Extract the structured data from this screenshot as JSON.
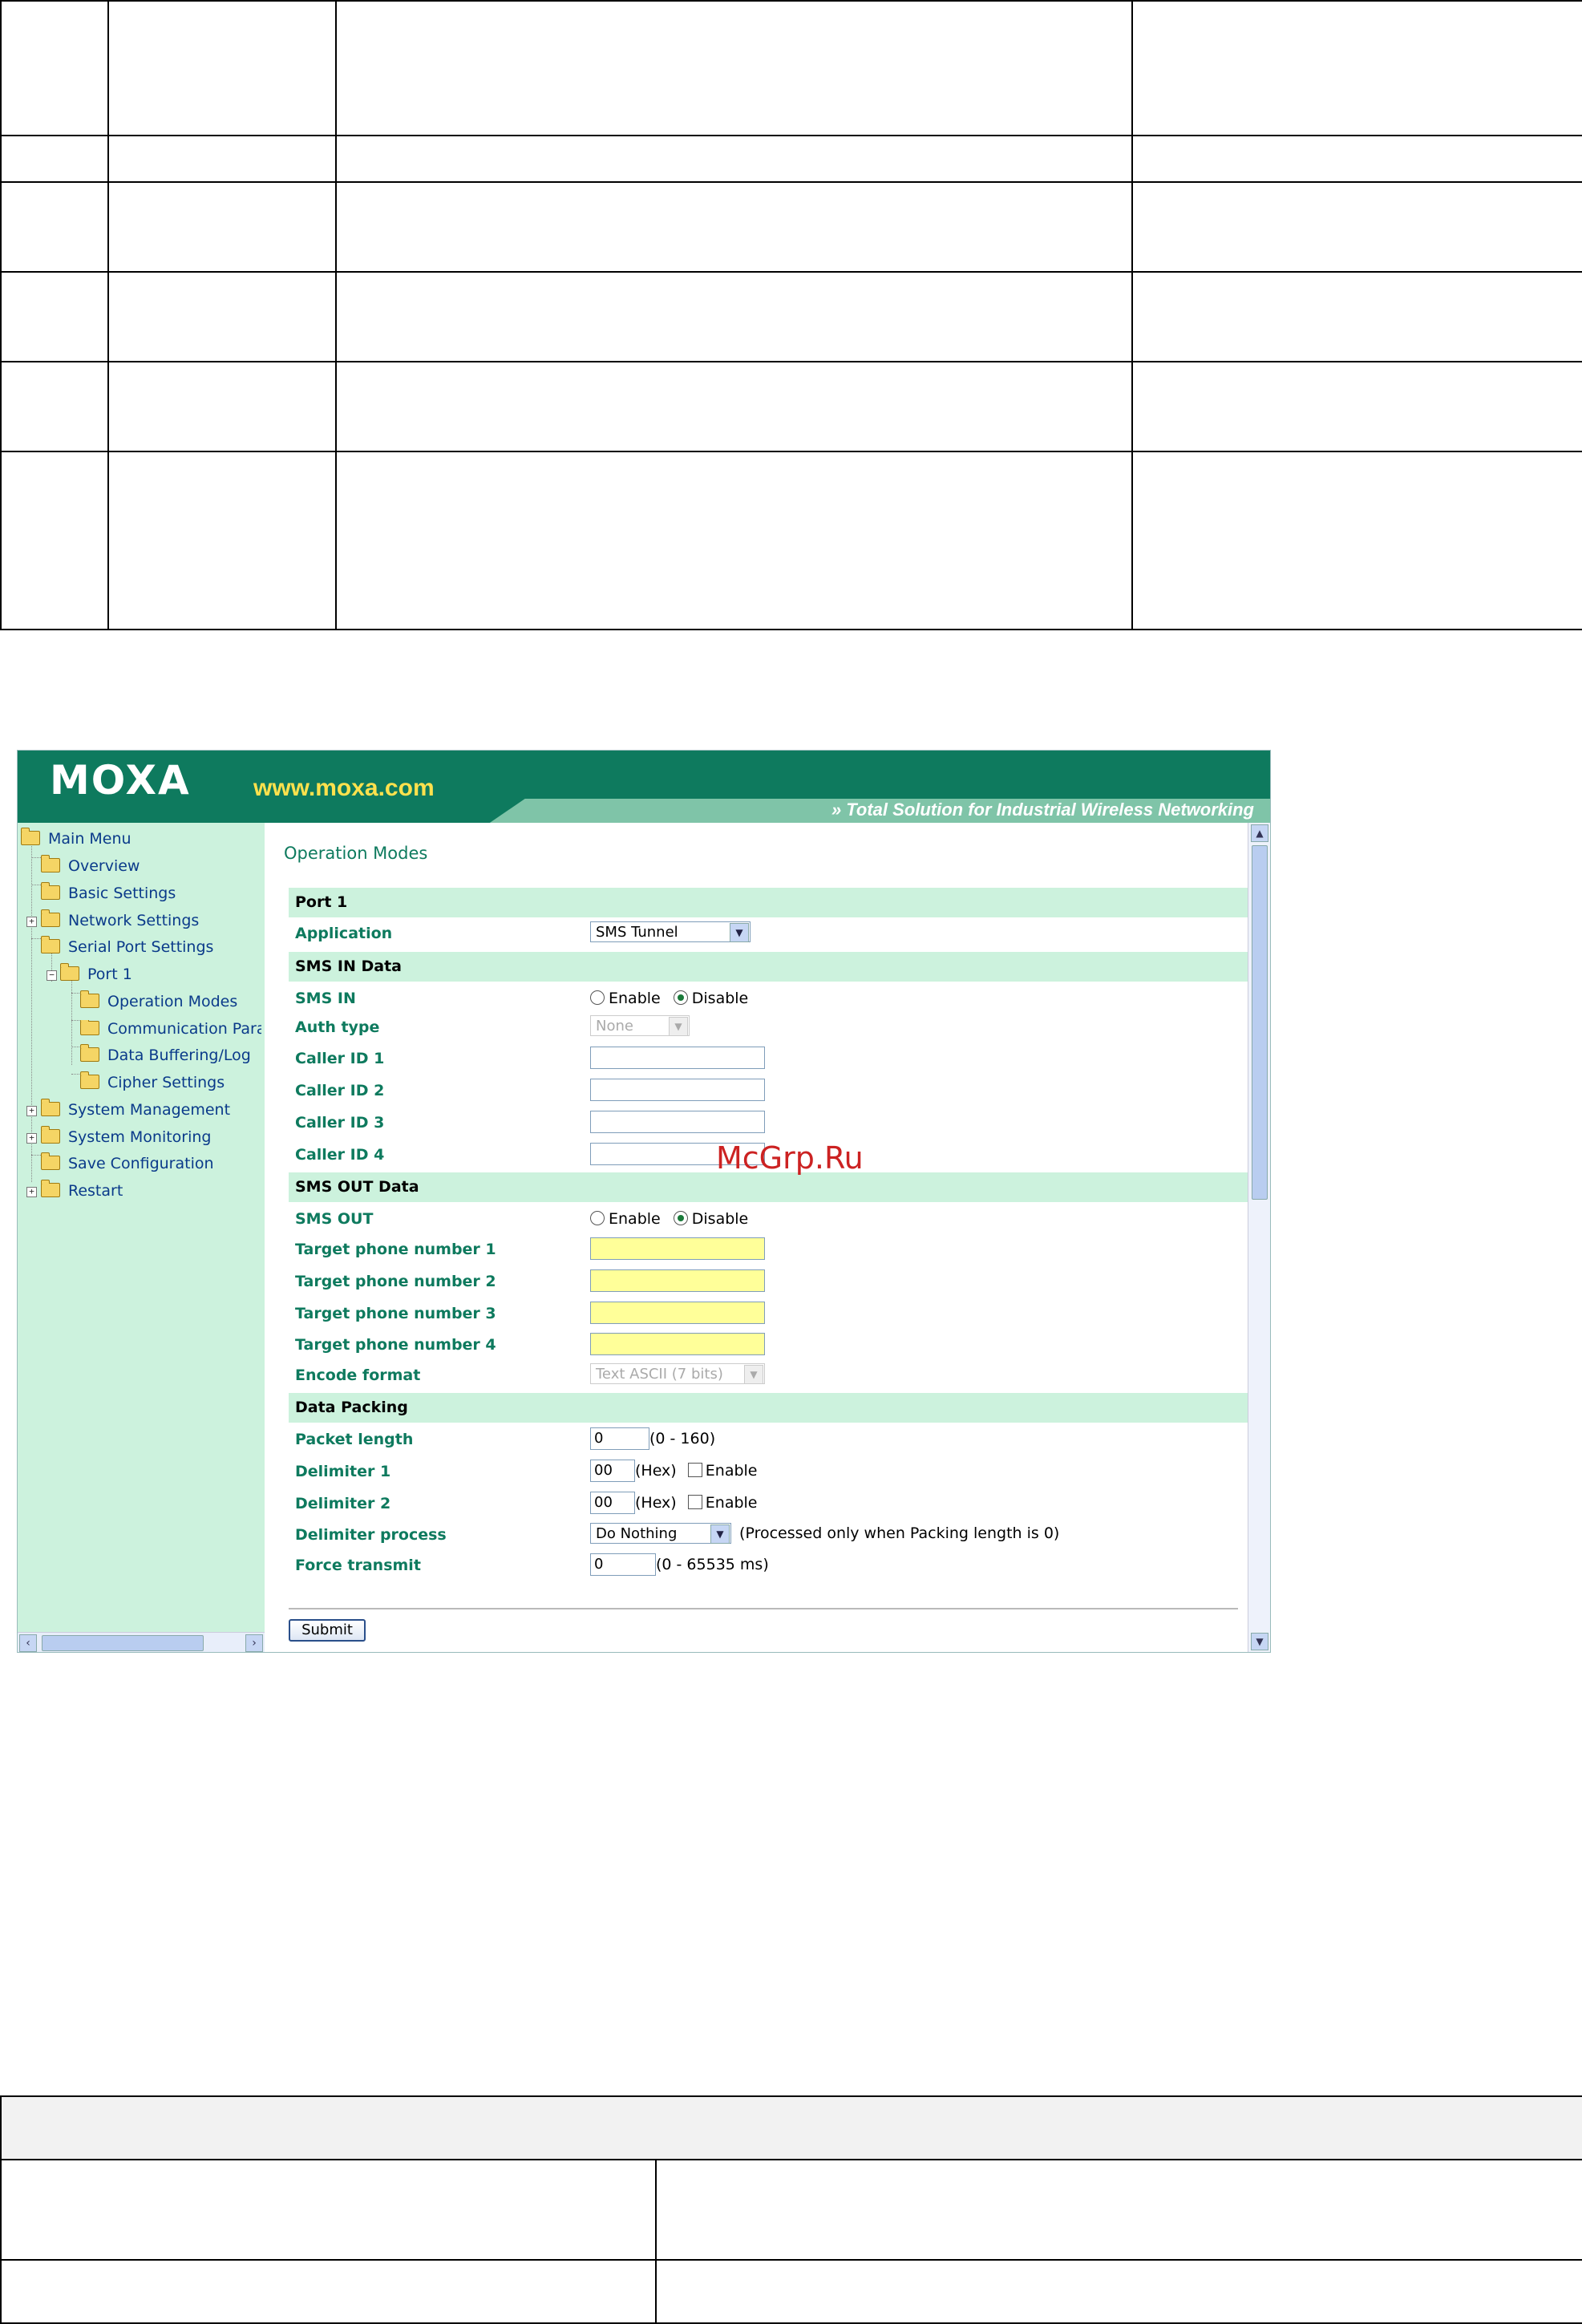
{
  "header": {
    "logo_text": "MOXA",
    "site_url": "www.moxa.com",
    "tagline": "Total Solution for Industrial Wireless Networking",
    "colors": {
      "brand": "#0e7a5e",
      "stripe": "#7fc4a8",
      "url": "#ffe14d"
    }
  },
  "sidebar": {
    "root": "Main Menu",
    "items": [
      {
        "label": "Overview"
      },
      {
        "label": "Basic Settings"
      },
      {
        "label": "Network Settings"
      },
      {
        "label": "Serial Port Settings"
      },
      {
        "label": "Port 1"
      },
      {
        "label": "Operation Modes"
      },
      {
        "label": "Communication Para"
      },
      {
        "label": "Data Buffering/Log"
      },
      {
        "label": "Cipher Settings"
      },
      {
        "label": "System Management"
      },
      {
        "label": "System Monitoring"
      },
      {
        "label": "Save Configuration"
      },
      {
        "label": "Restart"
      }
    ]
  },
  "main": {
    "title": "Operation Modes",
    "sections": {
      "port": "Port 1",
      "sms_in": "SMS IN Data",
      "sms_out": "SMS OUT Data",
      "packing": "Data Packing"
    },
    "fields": {
      "application": {
        "label": "Application",
        "value": "SMS Tunnel"
      },
      "sms_in": {
        "label": "SMS IN",
        "opt_enable": "Enable",
        "opt_disable": "Disable",
        "selected": "Disable"
      },
      "auth_type": {
        "label": "Auth type",
        "value": "None"
      },
      "caller_id_1": {
        "label": "Caller ID 1",
        "value": ""
      },
      "caller_id_2": {
        "label": "Caller ID 2",
        "value": ""
      },
      "caller_id_3": {
        "label": "Caller ID 3",
        "value": ""
      },
      "caller_id_4": {
        "label": "Caller ID 4",
        "value": ""
      },
      "sms_out": {
        "label": "SMS OUT",
        "opt_enable": "Enable",
        "opt_disable": "Disable",
        "selected": "Disable"
      },
      "target_1": {
        "label": "Target phone number 1",
        "value": ""
      },
      "target_2": {
        "label": "Target phone number 2",
        "value": ""
      },
      "target_3": {
        "label": "Target phone number 3",
        "value": ""
      },
      "target_4": {
        "label": "Target phone number 4",
        "value": ""
      },
      "encode_format": {
        "label": "Encode format",
        "value": "Text ASCII (7 bits)"
      },
      "packet_length": {
        "label": "Packet length",
        "value": "0",
        "hint": "(0 - 160)"
      },
      "delimiter_1": {
        "label": "Delimiter 1",
        "value": "00",
        "unit": "(Hex)",
        "check_label": "Enable"
      },
      "delimiter_2": {
        "label": "Delimiter 2",
        "value": "00",
        "unit": "(Hex)",
        "check_label": "Enable"
      },
      "delimiter_process": {
        "label": "Delimiter process",
        "value": "Do Nothing",
        "hint": "(Processed only when Packing length is 0)"
      },
      "force_transmit": {
        "label": "Force transmit",
        "value": "0",
        "hint": "(0 - 65535 ms)"
      }
    },
    "submit_label": "Submit"
  },
  "watermark": "McGrp.Ru"
}
